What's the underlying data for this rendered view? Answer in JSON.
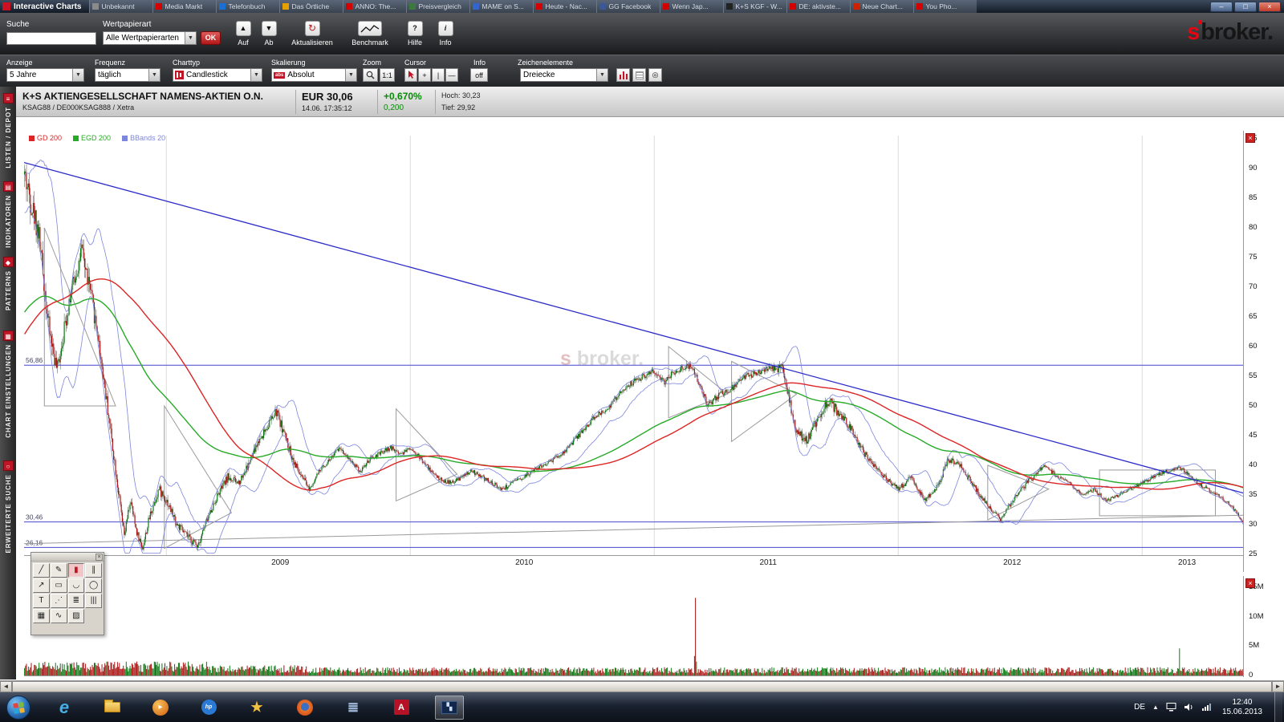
{
  "window": {
    "title": "Interactive Charts",
    "minimize_label": "–",
    "maximize_label": "□",
    "close_label": "×"
  },
  "ui": {
    "chevron": "▼",
    "close_glyph": "×",
    "scroll_left": "◄",
    "scroll_right": "►",
    "chevron_up": "▲"
  },
  "background_tabs": [
    {
      "label": "Unbekannt",
      "color": "#8a8a8a"
    },
    {
      "label": "Media Markt",
      "color": "#d40000"
    },
    {
      "label": "Telefonbuch",
      "color": "#1a6fd4"
    },
    {
      "label": "Das Örtliche",
      "color": "#e8a000"
    },
    {
      "label": "ANNO: The...",
      "color": "#d40000"
    },
    {
      "label": "Preisvergleich",
      "color": "#3a7a3a"
    },
    {
      "label": "MAME on S...",
      "color": "#3366cc"
    },
    {
      "label": "Heute - Nac...",
      "color": "#d40000"
    },
    {
      "label": "GG Facebook",
      "color": "#3b5998"
    },
    {
      "label": "Wenn Jap...",
      "color": "#d40000"
    },
    {
      "label": "K+S KGF - W...",
      "color": "#222222"
    },
    {
      "label": "DE: aktivste...",
      "color": "#d40000"
    },
    {
      "label": "Neue Chart...",
      "color": "#cc2200"
    },
    {
      "label": "You Pho...",
      "color": "#d40000"
    }
  ],
  "toolbar1": {
    "suche_label": "Suche",
    "suche_value": "",
    "wertpapierart_label": "Wertpapierart",
    "wertpapierart_value": "Alle Wertpapierarten",
    "ok_label": "OK",
    "auf_label": "Auf",
    "auf_glyph": "▲",
    "ab_label": "Ab",
    "ab_glyph": "▼",
    "aktualisieren_label": "Aktualisieren",
    "aktualisieren_glyph": "↻",
    "benchmark_label": "Benchmark",
    "hilfe_label": "Hilfe",
    "hilfe_glyph": "?",
    "info_label": "Info",
    "info_glyph": "i",
    "logo_s": "s",
    "logo_text": "broker."
  },
  "toolbar2": {
    "anzeige_label": "Anzeige",
    "anzeige_value": "5 Jahre",
    "frequenz_label": "Frequenz",
    "frequenz_value": "täglich",
    "charttyp_label": "Charttyp",
    "charttyp_value": "Candlestick",
    "skalierung_label": "Skalierung",
    "skalierung_value": "Absolut",
    "skalierung_badge": "abs",
    "zoom_label": "Zoom",
    "zoom_ratio": "1:1",
    "cursor_label": "Cursor",
    "cursor_cross_glyph": "+",
    "cursor_vline_glyph": "|",
    "cursor_hline_glyph": "—",
    "info_label": "Info",
    "info_value": "off",
    "zeichenelemente_label": "Zeichenelemente",
    "zeichenelemente_value": "Dreiecke",
    "settings_glyph": "◎"
  },
  "quote": {
    "name": "K+S AKTIENGESELLSCHAFT NAMENS-AKTIEN O.N.",
    "identifiers": "KSAG88 / DE000KSAG888 / Xetra",
    "price": "EUR 30,06",
    "datetime": "14.06. 17:35:12",
    "change_pct": "+0,670%",
    "change_abs": "0,200",
    "high_label": "Hoch: 30,23",
    "low_label": "Tief: 29,92"
  },
  "sidebar": {
    "items": [
      {
        "id": "listen-depot",
        "label": "LISTEN / DEPOT",
        "icon": "depot-icon",
        "icon_glyph": "≡"
      },
      {
        "id": "indikatoren",
        "label": "INDIKATOREN",
        "icon": "indicators-icon",
        "icon_glyph": "▤"
      },
      {
        "id": "patterns",
        "label": "PATTERNS",
        "icon": "patterns-icon",
        "icon_glyph": "◆"
      },
      {
        "id": "chart-einstellungen",
        "label": "CHART EINSTELLUNGEN",
        "icon": "chart-settings-icon",
        "icon_glyph": "▦"
      },
      {
        "id": "erweiterte-suche",
        "label": "ERWEITERTE SUCHE",
        "icon": "advanced-search-icon",
        "icon_glyph": "○"
      }
    ]
  },
  "legend": [
    {
      "label": "GD 200",
      "color": "#dd2424"
    },
    {
      "label": "EGD 200",
      "color": "#27aa27"
    },
    {
      "label": "BBands 20",
      "color": "#7c86dd"
    }
  ],
  "levels": [
    {
      "label": "56,86",
      "price": 56.86
    },
    {
      "label": "30,46",
      "price": 30.46
    },
    {
      "label": "26,16",
      "price": 26.16
    }
  ],
  "price_axis": [
    95,
    90,
    85,
    80,
    75,
    70,
    65,
    60,
    55,
    50,
    45,
    40,
    35,
    30,
    25
  ],
  "volume_axis": [
    {
      "label": "15M",
      "value": 15
    },
    {
      "label": "10M",
      "value": 10
    },
    {
      "label": "5M",
      "value": 5
    },
    {
      "label": "0",
      "value": 0
    }
  ],
  "x_axis_years": [
    {
      "label": "2009",
      "month": 12.6
    },
    {
      "label": "2010",
      "month": 24.6
    },
    {
      "label": "2011",
      "month": 36.6
    },
    {
      "label": "2012",
      "month": 48.6
    },
    {
      "label": "2013",
      "month": 57.2
    }
  ],
  "watermark": {
    "s": "s",
    "text": "broker."
  },
  "chart_data": {
    "type": "candlestick",
    "title": "K+S Aktiengesellschaft Namens-Aktien o.N.",
    "period_years": 5,
    "frequency": "daily",
    "ylim": [
      25,
      95
    ],
    "months_total": 60,
    "seed": 42,
    "price_anchors": [
      [
        0,
        89
      ],
      [
        0.7,
        79
      ],
      [
        1.2,
        63
      ],
      [
        1.6,
        56
      ],
      [
        2.2,
        68
      ],
      [
        2.8,
        76
      ],
      [
        3.2,
        70
      ],
      [
        3.6,
        62
      ],
      [
        4,
        52
      ],
      [
        4.3,
        44
      ],
      [
        4.6,
        36
      ],
      [
        4.9,
        28
      ],
      [
        5.2,
        34
      ],
      [
        5.5,
        29
      ],
      [
        5.8,
        26
      ],
      [
        6.2,
        32
      ],
      [
        6.6,
        36
      ],
      [
        7,
        34
      ],
      [
        7.5,
        30
      ],
      [
        8,
        28
      ],
      [
        8.5,
        26.5
      ],
      [
        9,
        31
      ],
      [
        9.5,
        35
      ],
      [
        10,
        38
      ],
      [
        10.5,
        37
      ],
      [
        11,
        40
      ],
      [
        11.5,
        44
      ],
      [
        12,
        47
      ],
      [
        12.4,
        49
      ],
      [
        12.8,
        45
      ],
      [
        13.2,
        41
      ],
      [
        13.6,
        38
      ],
      [
        14,
        36
      ],
      [
        14.5,
        39
      ],
      [
        15,
        41
      ],
      [
        15.5,
        43
      ],
      [
        16,
        41
      ],
      [
        16.5,
        39
      ],
      [
        17,
        41
      ],
      [
        17.5,
        42
      ],
      [
        18,
        43
      ],
      [
        18.5,
        42
      ],
      [
        19,
        43
      ],
      [
        19.5,
        41
      ],
      [
        20,
        39
      ],
      [
        20.5,
        37.5
      ],
      [
        21,
        37
      ],
      [
        21.5,
        38
      ],
      [
        22,
        39
      ],
      [
        22.5,
        38
      ],
      [
        23,
        37
      ],
      [
        23.5,
        36
      ],
      [
        24,
        37
      ],
      [
        24.5,
        38
      ],
      [
        25,
        39
      ],
      [
        25.5,
        40
      ],
      [
        26,
        41
      ],
      [
        26.5,
        42
      ],
      [
        27,
        44
      ],
      [
        27.5,
        46
      ],
      [
        28,
        48
      ],
      [
        28.8,
        50
      ],
      [
        29.5,
        53
      ],
      [
        30.4,
        55
      ],
      [
        31,
        56
      ],
      [
        31.5,
        54
      ],
      [
        32,
        56
      ],
      [
        32.8,
        57
      ],
      [
        33.6,
        50
      ],
      [
        34.2,
        52
      ],
      [
        34.8,
        53
      ],
      [
        35.5,
        55
      ],
      [
        36.3,
        56
      ],
      [
        37,
        56.5
      ],
      [
        37.3,
        57
      ],
      [
        37.9,
        46
      ],
      [
        38.5,
        44
      ],
      [
        39,
        48
      ],
      [
        39.5,
        51
      ],
      [
        40,
        49
      ],
      [
        40.7,
        46
      ],
      [
        41.3,
        42
      ],
      [
        42.3,
        38
      ],
      [
        43,
        36
      ],
      [
        43.6,
        38
      ],
      [
        44.3,
        34
      ],
      [
        45,
        37
      ],
      [
        45.4,
        41
      ],
      [
        46,
        40
      ],
      [
        46.6,
        37
      ],
      [
        47.2,
        34
      ],
      [
        48,
        30.8
      ],
      [
        48.6,
        34
      ],
      [
        49.3,
        37
      ],
      [
        50.2,
        40
      ],
      [
        50.8,
        38
      ],
      [
        51.4,
        37
      ],
      [
        52,
        35
      ],
      [
        52.6,
        36
      ],
      [
        53.2,
        34
      ],
      [
        53.8,
        35
      ],
      [
        54.4,
        36
      ],
      [
        54.9,
        37
      ],
      [
        55.5,
        38
      ],
      [
        56.2,
        39
      ],
      [
        56.9,
        39.5
      ],
      [
        57.4,
        38
      ],
      [
        57.9,
        36.5
      ],
      [
        58.4,
        35.5
      ],
      [
        58.9,
        34.5
      ],
      [
        59.4,
        33
      ],
      [
        59.7,
        31.5
      ],
      [
        60,
        30.06
      ]
    ],
    "volatility_eras": [
      [
        0,
        1.5,
        0.04
      ],
      [
        1.5,
        9,
        0.034
      ],
      [
        9,
        14,
        0.025
      ],
      [
        14,
        31,
        0.014
      ],
      [
        31,
        37,
        0.015
      ],
      [
        37,
        40,
        0.026
      ],
      [
        40,
        50,
        0.019
      ],
      [
        50,
        60,
        0.013
      ]
    ],
    "prehistory": {
      "days": 200,
      "from": 36,
      "to": 88
    },
    "indicators": {
      "sma_period": 200,
      "ema_period": 200,
      "bollinger_period": 20,
      "bollinger_k": 2
    },
    "year_boundaries_months": [
      7,
      19,
      31,
      43,
      55
    ],
    "volume": {
      "ylim_millions": [
        0,
        15
      ],
      "era_mult": [
        [
          0,
          9,
          1.7
        ],
        [
          9,
          14,
          1.25
        ],
        [
          14,
          60,
          1.0
        ]
      ],
      "spikes": [
        {
          "month": 33.0,
          "millions": 13.2,
          "dir": "red"
        },
        {
          "month": 56.8,
          "millions": 4.6,
          "dir": "green"
        }
      ]
    },
    "drawings": {
      "trendline_down": {
        "points": [
          [
            0,
            91
          ],
          [
            60,
            35.3
          ]
        ],
        "color": "#2a2ac8"
      },
      "trendline_up_gray": {
        "points": [
          [
            0,
            26.8
          ],
          [
            60,
            31.6
          ]
        ],
        "color": "#9a9a9a"
      },
      "triangles": [
        [
          [
            1.0,
            80
          ],
          [
            4.5,
            50
          ],
          [
            1.0,
            50
          ]
        ],
        [
          [
            6.9,
            50
          ],
          [
            10.2,
            32
          ],
          [
            6.9,
            26
          ]
        ],
        [
          [
            18.3,
            49.5
          ],
          [
            21.3,
            38.5
          ],
          [
            18.3,
            34
          ]
        ],
        [
          [
            31.7,
            60
          ],
          [
            34.6,
            52
          ],
          [
            31.7,
            48
          ]
        ],
        [
          [
            34.8,
            57.5
          ],
          [
            38.0,
            52
          ],
          [
            34.8,
            44
          ]
        ],
        [
          [
            47.4,
            40
          ],
          [
            50.4,
            36
          ],
          [
            47.4,
            30.8
          ]
        ]
      ],
      "rectangle": {
        "m0": 52.9,
        "p0": 31.5,
        "m1": 58.6,
        "p1": 39.2
      }
    }
  },
  "palette": {
    "tools": [
      {
        "name": "line-tool",
        "glyph": "╱"
      },
      {
        "name": "pencil-tool",
        "glyph": "✎"
      },
      {
        "name": "filled-rect-tool",
        "glyph": "▮",
        "active": true
      },
      {
        "name": "parallel-lines-tool",
        "glyph": "∥"
      },
      {
        "name": "arrow-tool",
        "glyph": "↗"
      },
      {
        "name": "rectangle-tool",
        "glyph": "▭"
      },
      {
        "name": "arc-tool",
        "glyph": "◡"
      },
      {
        "name": "ellipse-tool",
        "glyph": "◯"
      },
      {
        "name": "text-tool",
        "glyph": "T"
      },
      {
        "name": "trend-channel-tool",
        "glyph": "⋰"
      },
      {
        "name": "fibonacci-tool",
        "glyph": "≣"
      },
      {
        "name": "vertical-lines-tool",
        "glyph": "|||"
      },
      {
        "name": "grid-tool",
        "glyph": "▦"
      },
      {
        "name": "freehand-tool",
        "glyph": "∿"
      },
      {
        "name": "eraser-tool",
        "glyph": "▨"
      }
    ]
  },
  "taskbar": {
    "lang_indicator": "DE",
    "clock_time": "12:40",
    "clock_date": "15.06.2013",
    "icons": [
      {
        "name": "internet-explorer-icon",
        "glyph": "e",
        "color": "#45b0e8"
      },
      {
        "name": "explorer-folder-icon"
      },
      {
        "name": "media-player-icon"
      },
      {
        "name": "hp-icon",
        "glyph": "hp"
      },
      {
        "name": "bookmark-star-icon",
        "glyph": "★",
        "color": "#f0c040"
      },
      {
        "name": "firefox-icon"
      },
      {
        "name": "utility-icon",
        "glyph": "≣",
        "color": "#9fb8d8"
      },
      {
        "name": "adobe-reader-icon",
        "glyph": "A"
      },
      {
        "name": "chart-app-icon",
        "active": true
      }
    ]
  }
}
